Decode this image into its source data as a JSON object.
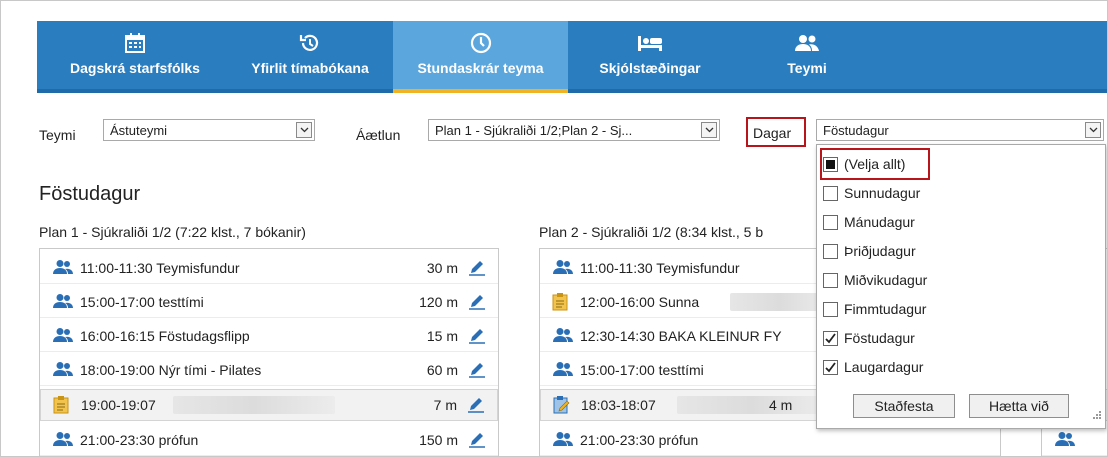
{
  "nav": {
    "items": [
      {
        "label": "Dagskrá starfsfólks",
        "icon": "calendar-icon"
      },
      {
        "label": "Yfirlit tímabókana",
        "icon": "history-icon"
      },
      {
        "label": "Stundaskrár teyma",
        "icon": "clock-icon"
      },
      {
        "label": "Skjólstæðingar",
        "icon": "bed-icon"
      },
      {
        "label": "Teymi",
        "icon": "team-icon"
      }
    ]
  },
  "filters": {
    "team_label": "Teymi",
    "team_value": "Ástuteymi",
    "plan_label": "Áætlun",
    "plan_value": "Plan 1 - Sjúkraliði 1/2;Plan 2 - Sj...",
    "days_label": "Dagar",
    "days_value": "Föstudagur"
  },
  "day_title": "Föstudagur",
  "plans": [
    {
      "title": "Plan 1 - Sjúkraliði 1/2 (7:22 klst., 7 bókanir)",
      "rows": [
        {
          "time": "11:00-11:30",
          "text": "Teymisfundur",
          "duration": "30 m",
          "icon": "group-icon"
        },
        {
          "time": "15:00-17:00",
          "text": "testtími",
          "duration": "120 m",
          "icon": "group-icon"
        },
        {
          "time": "16:00-16:15",
          "text": "Föstudagsflipp",
          "duration": "15 m",
          "icon": "group-icon"
        },
        {
          "time": "18:00-19:00",
          "text": "Nýr tími - Pilates",
          "duration": "60 m",
          "icon": "group-icon"
        },
        {
          "time": "19:00-19:07",
          "text": "",
          "duration": "7 m",
          "icon": "clipboard-icon"
        },
        {
          "time": "21:00-23:30",
          "text": "prófun",
          "duration": "150 m",
          "icon": "group-icon"
        }
      ]
    },
    {
      "title": "Plan 2 - Sjúkraliði 1/2 (8:34 klst., 5 b",
      "rows": [
        {
          "time": "11:00-11:30",
          "text": "Teymisfundur",
          "duration": "",
          "icon": "group-icon"
        },
        {
          "time": "12:00-16:00",
          "text": "Sunna",
          "duration": "",
          "icon": "clipboard-icon"
        },
        {
          "time": "12:30-14:30",
          "text": "BAKA KLEINUR FY",
          "duration": "",
          "icon": "group-icon"
        },
        {
          "time": "15:00-17:00",
          "text": "testtími",
          "duration": "",
          "icon": "group-icon"
        },
        {
          "time": "18:03-18:07",
          "text": "",
          "duration": "4 m",
          "icon": "clipboard-edit-icon"
        },
        {
          "time": "21:00-23:30",
          "text": "prófun",
          "duration": "",
          "icon": "group-icon"
        }
      ]
    }
  ],
  "days_dropdown": {
    "options": [
      {
        "label": "(Velja allt)",
        "state": "partial"
      },
      {
        "label": "Sunnudagur",
        "state": "unchecked"
      },
      {
        "label": "Mánudagur",
        "state": "unchecked"
      },
      {
        "label": "Þriðjudagur",
        "state": "unchecked"
      },
      {
        "label": "Miðvikudagur",
        "state": "unchecked"
      },
      {
        "label": "Fimmtudagur",
        "state": "unchecked"
      },
      {
        "label": "Föstudagur",
        "state": "checked"
      },
      {
        "label": "Laugardagur",
        "state": "checked"
      }
    ],
    "confirm_label": "Staðfesta",
    "cancel_label": "Hætta við"
  },
  "colors": {
    "nav_bg": "#2a7dbf",
    "nav_active": "#5aa6dd",
    "nav_underline": "#f0b323",
    "highlight": "#b8141b",
    "icon_blue": "#2a6fb6"
  }
}
